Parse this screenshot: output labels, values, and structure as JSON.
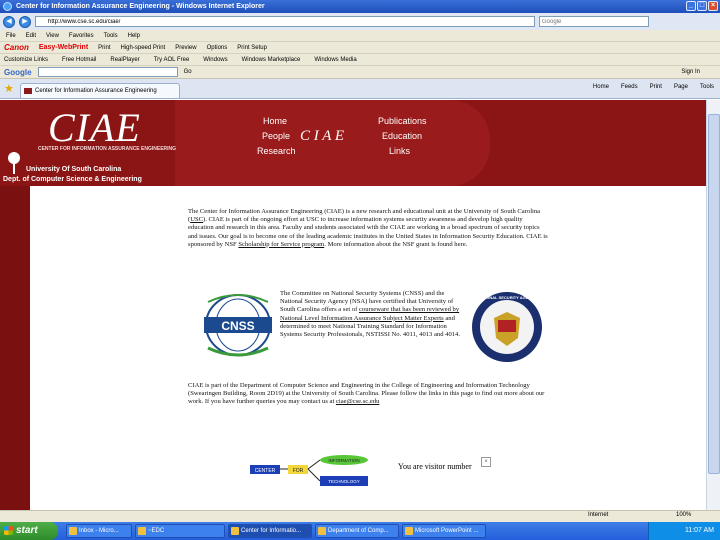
{
  "window": {
    "title": "Center for Information Assurance Engineering - Windows Internet Explorer",
    "buttons": [
      "_",
      "□",
      "×"
    ]
  },
  "address": {
    "url": "http://www.cse.sc.edu/ciae/",
    "search_placeholder": "Google"
  },
  "menu": [
    "File",
    "Edit",
    "View",
    "Favorites",
    "Tools",
    "Help"
  ],
  "canon_toolbar": {
    "brand": "Canon",
    "product": "Easy-WebPrint",
    "items": [
      "Print",
      "High-speed Print",
      "Preview",
      "Options",
      "Print Setup"
    ]
  },
  "links_bar": {
    "items": [
      "Customize Links",
      "Free Hotmail",
      "RealPlayer",
      "Try AOL Free",
      "Windows",
      "Windows Marketplace",
      "Windows Media"
    ]
  },
  "google_bar": {
    "logo": "Google",
    "go_label": "Go",
    "sign_in": "Sign In"
  },
  "tab": {
    "label": "Center for Information Assurance Engineering"
  },
  "tab_tools": [
    "Home",
    "Feeds",
    "Print",
    "Page",
    "Tools"
  ],
  "header": {
    "logo": "CIAE",
    "logo_sub": "CENTER FOR INFORMATION ASSURANCE ENGINEERING",
    "university": "University Of South Carolina",
    "department": "Dept. of Computer Science & Engineering",
    "center_glyph": "C I A E",
    "nav": {
      "home": "Home",
      "people": "People",
      "research": "Research",
      "publications": "Publications",
      "education": "Education",
      "links": "Links"
    }
  },
  "content": {
    "intro_1": "The Center for Information Assurance Engineering (CIAE) is a new research and educational unit at the University of South Carolina (",
    "usc_link": "USC",
    "intro_2": "). CIAE is part of the ongoing effort at USC to increase information systems security awareness and develop high quality education and research in this area. Faculty and students associated with the CIAE are working in a broad spectrum of security topics and issues. Our goal is to become one of the leading academic institutes in the United States in Information Security Education. CIAE is sponsored by NSF ",
    "nsf_link": "Scholarship for Service program",
    "intro_3": ". More information about the NSF grant is found here.",
    "cnss_1": "The Committee on National Security Systems (CNSS) and the National Security Agency (NSA) have certified that University of South Carolina offers a set of ",
    "cnss_link": "courseware that has been reviewed by National Level Information Assurance Subject Matter Experts",
    "cnss_2": " and determined to meet National Training Standard for Information Systems Security Professionals, NSTISSI No. 4011, 4013 and 4014.",
    "dept_para": "CIAE is part of the Department of Computer Science and Engineering in the College of Engineering and Information Technology (Swearingen Building, Room 2D19) at the University of South Carolina. Please follow the links in this page to find out more about our work. If you have further queries you may contact us at ",
    "email": "ciae@cse.sc.edu",
    "visitor": "You are visitor number",
    "cnss_badge": "CNSS",
    "nsa_badge": "NATIONAL SECURITY AGENCY",
    "graphic_center": "CENTER",
    "graphic_for": "FOR",
    "graphic_info": "INFORMATION",
    "graphic_tech": "TECHNOLOGY"
  },
  "status": {
    "zone": "Internet",
    "zoom": "100%"
  },
  "taskbar": {
    "start": "start",
    "items": [
      "Inbox - Micro...",
      "~EDC",
      "Center for Informatio...",
      "Department of Comp...",
      "Microsoft PowerPoint ..."
    ],
    "clock": "11:07 AM"
  }
}
